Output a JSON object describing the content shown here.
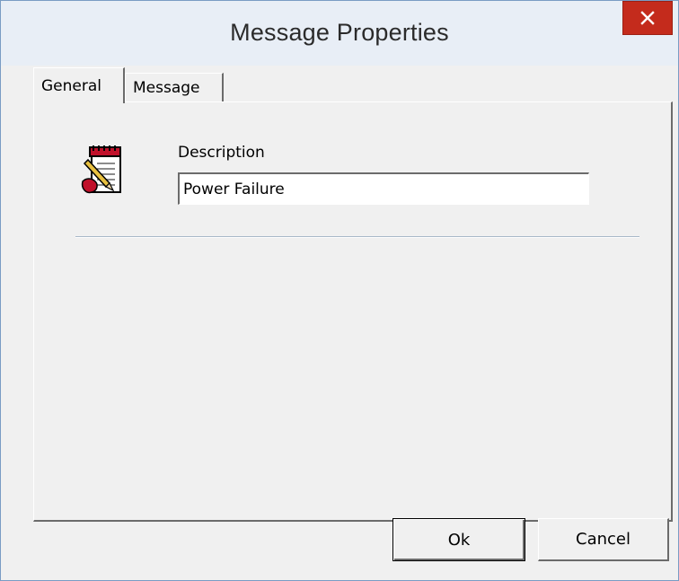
{
  "window": {
    "title": "Message Properties",
    "close_glyph": "✕"
  },
  "tabs": [
    {
      "label": "General",
      "selected": true
    },
    {
      "label": "Message",
      "selected": false
    }
  ],
  "general": {
    "icon": "notepad-pencil-icon",
    "description_label": "Description",
    "description_value": "Power Failure"
  },
  "buttons": {
    "ok": "Ok",
    "cancel": "Cancel"
  },
  "colors": {
    "close_button": "#c42b1c",
    "titlebar": "#e8eef6",
    "face": "#f0f0f0"
  }
}
